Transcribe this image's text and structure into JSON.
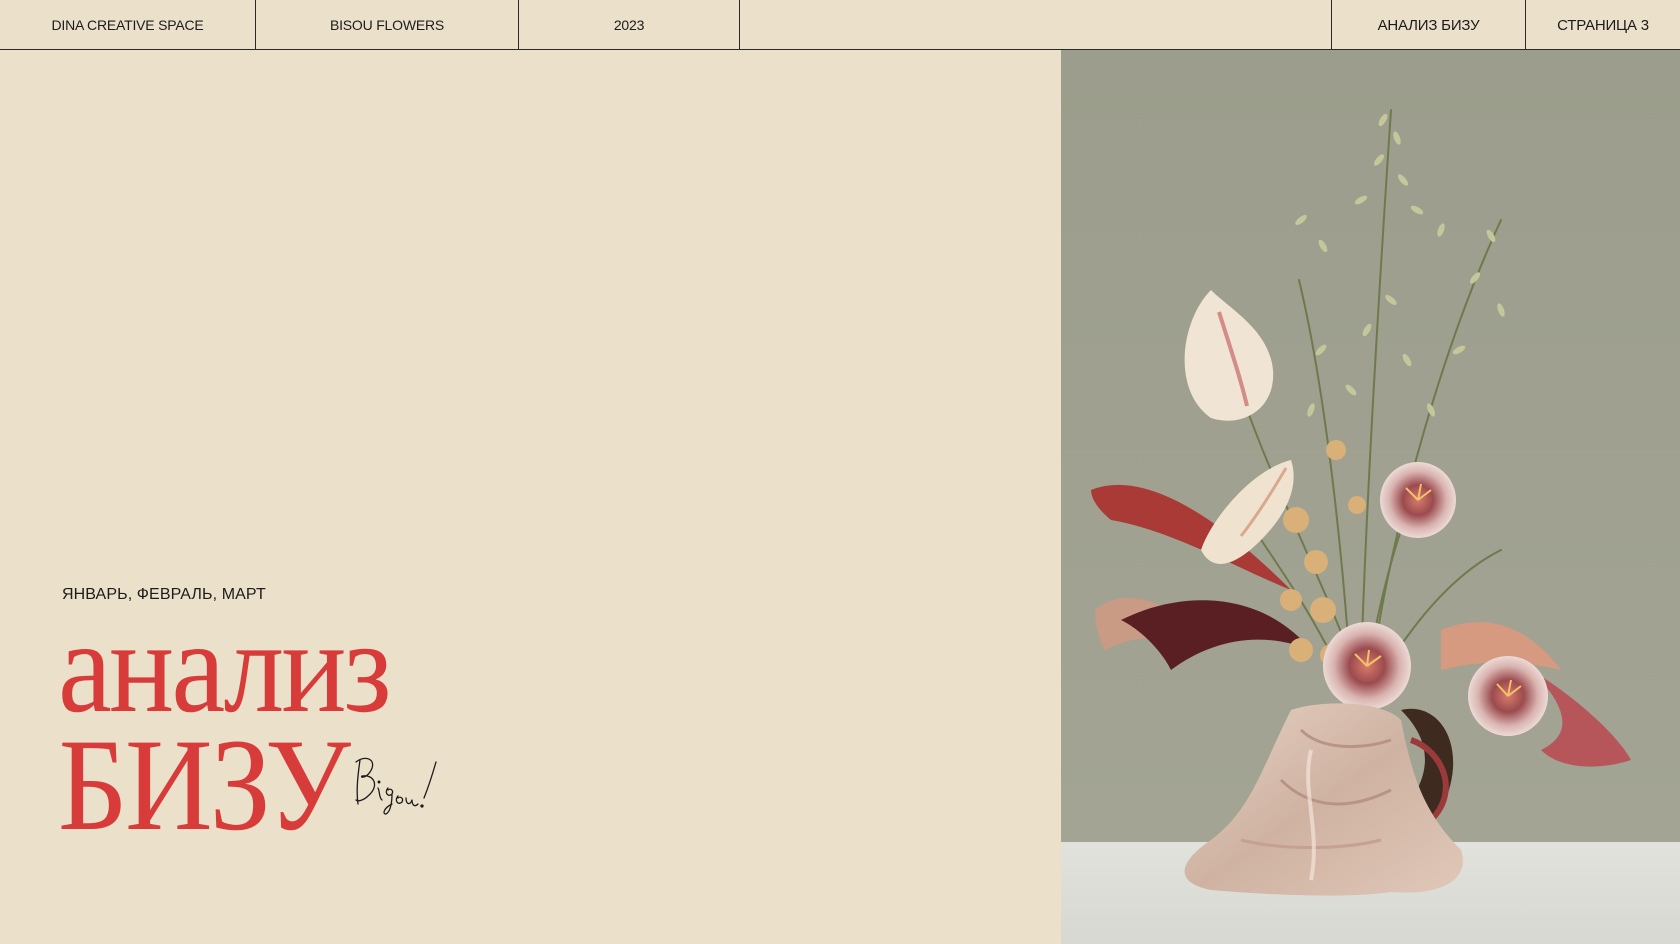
{
  "header": {
    "brand": "DINA CREATIVE SPACE",
    "client": "BISOU FLOWERS",
    "year": "2023",
    "section": "АНАЛИЗ БИЗУ",
    "page": "СТРАНИЦА 3"
  },
  "hero": {
    "period": "ЯНВАРЬ, ФЕВРАЛЬ, МАРТ",
    "title_line1": "анализ",
    "title_line2": "БИЗУ",
    "signature_text": "Bisou!"
  },
  "photo": {
    "subject": "flower-arrangement-in-draped-vase"
  },
  "colors": {
    "background": "#ebe0c9",
    "accent": "#d83c3a",
    "text": "#1c1c1c",
    "photo_backdrop": "#9fa08f",
    "table_surface": "#dcdcd6"
  }
}
